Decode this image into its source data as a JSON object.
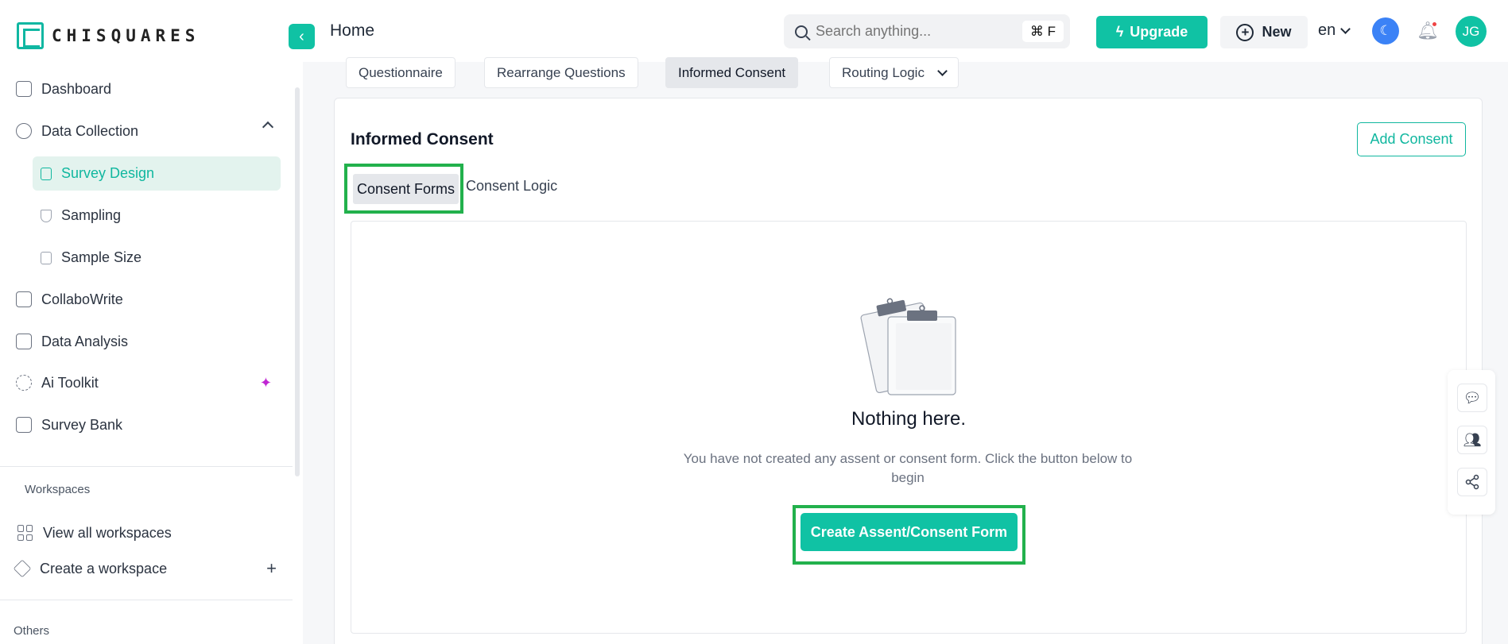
{
  "brand": {
    "name": "CHISQUARES"
  },
  "header": {
    "title": "Home",
    "search_placeholder": "Search anything...",
    "search_shortcut": "⌘ F",
    "upgrade_label": "Upgrade",
    "new_label": "New",
    "language": "en",
    "avatar_initials": "JG"
  },
  "sidebar": {
    "items": [
      {
        "label": "Dashboard"
      },
      {
        "label": "Data Collection"
      },
      {
        "label": "Survey Design"
      },
      {
        "label": "Sampling"
      },
      {
        "label": "Sample Size"
      },
      {
        "label": "CollaboWrite"
      },
      {
        "label": "Data Analysis"
      },
      {
        "label": "Ai Toolkit"
      },
      {
        "label": "Survey Bank"
      }
    ],
    "workspaces_label": "Workspaces",
    "view_all_workspaces": "View all workspaces",
    "create_workspace": "Create a workspace",
    "others_label": "Others"
  },
  "tabs": [
    {
      "label": "Questionnaire"
    },
    {
      "label": "Rearrange Questions"
    },
    {
      "label": "Informed Consent"
    },
    {
      "label": "Routing Logic"
    }
  ],
  "consent": {
    "title": "Informed Consent",
    "add_button": "Add Consent",
    "sub_tabs": [
      "Consent Forms",
      "Consent Logic"
    ],
    "empty_title": "Nothing here.",
    "empty_description": "You have not created any assent or consent form. Click the button below to begin",
    "create_button": "Create Assent/Consent Form"
  }
}
